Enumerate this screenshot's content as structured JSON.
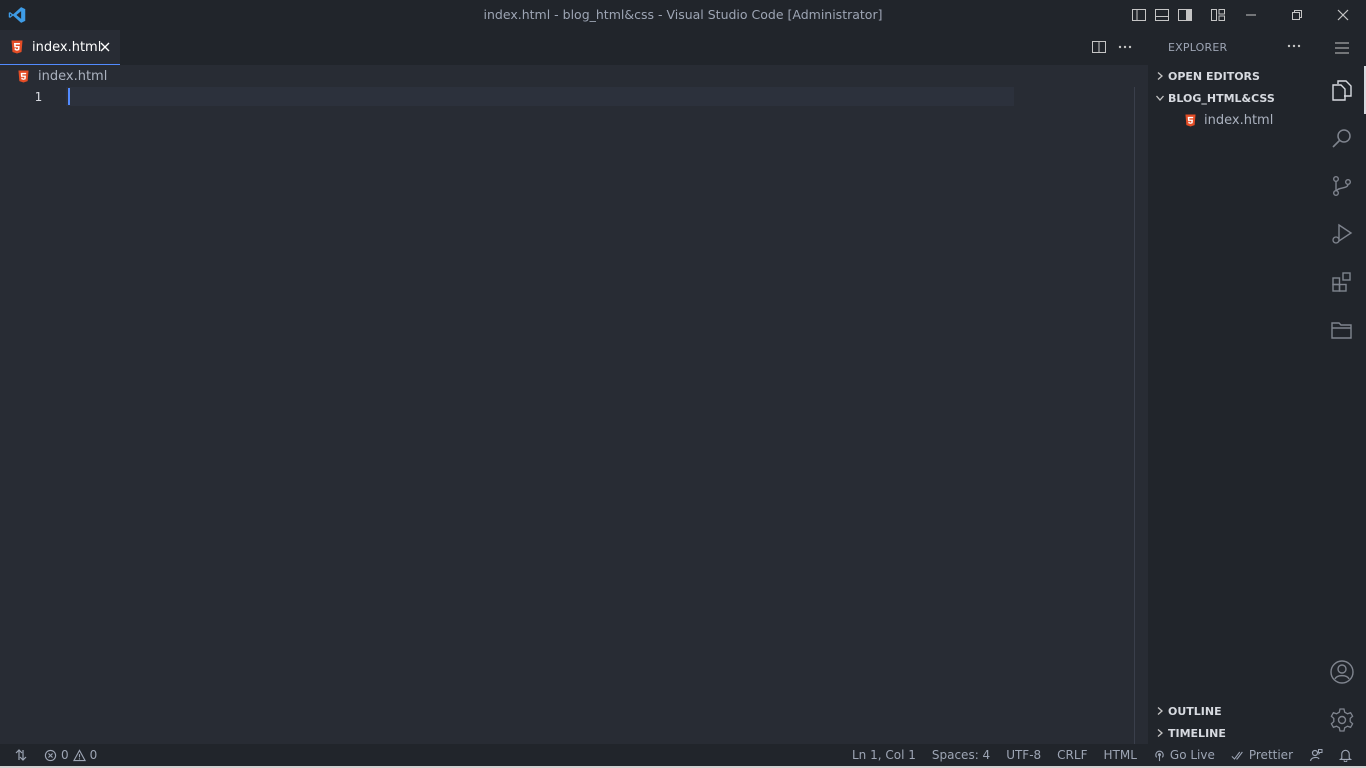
{
  "window": {
    "title": "index.html - blog_html&css - Visual Studio Code [Administrator]"
  },
  "tabs": [
    {
      "label": "index.html",
      "icon": "html5-file-icon",
      "active": true
    }
  ],
  "breadcrumb": {
    "file": "index.html"
  },
  "editor": {
    "lines": [
      {
        "number": "1",
        "text": ""
      }
    ]
  },
  "explorer": {
    "title": "EXPLORER",
    "sections": {
      "open_editors": "OPEN EDITORS",
      "folder": "BLOG_HTML&CSS",
      "outline": "OUTLINE",
      "timeline": "TIMELINE"
    },
    "files": [
      {
        "name": "index.html",
        "icon": "html5-file-icon"
      }
    ]
  },
  "activity_bar": {
    "items": [
      "explorer-icon",
      "search-icon",
      "source-control-icon",
      "run-debug-icon",
      "extensions-icon",
      "remote-explorer-icon"
    ],
    "bottom": [
      "accounts-icon",
      "manage-gear-icon"
    ]
  },
  "statusbar": {
    "errors": "0",
    "warnings": "0",
    "position": "Ln 1, Col 1",
    "spaces": "Spaces: 4",
    "encoding": "UTF-8",
    "eol": "CRLF",
    "language": "HTML",
    "go_live": "Go Live",
    "prettier": "Prettier"
  },
  "colors": {
    "accent": "#528bff",
    "html_icon": "#e44d26",
    "vscode_logo": "#3e9ce6"
  }
}
